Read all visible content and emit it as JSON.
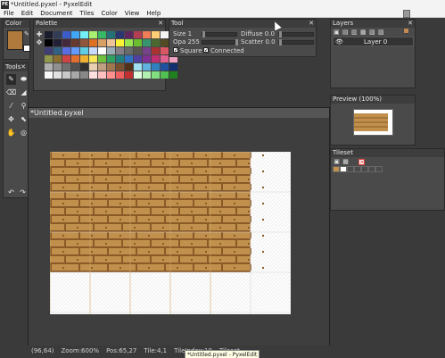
{
  "window": {
    "title": "*Untitled.pyxel - PyxelEdit",
    "icon_label": "PE"
  },
  "menu": [
    "File",
    "Edit",
    "Document",
    "Tiles",
    "Color",
    "View",
    "Help"
  ],
  "panels": {
    "color": {
      "title": "Color",
      "primary": "#b07a3c",
      "secondary": "#ffffff"
    },
    "palette": {
      "title": "Palette",
      "colors": [
        "#1a1c2c",
        "#333c57",
        "#3b5dc9",
        "#41a6f6",
        "#73eff7",
        "#a7f070",
        "#38b764",
        "#257179",
        "#29366f",
        "#5d275d",
        "#b13e53",
        "#ef7d57",
        "#ffcd75",
        "#f4f4f4",
        "#94b0c2",
        "#000000",
        "#222034",
        "#45283c",
        "#663931",
        "#8f563b",
        "#df7126",
        "#d9a066",
        "#eec39a",
        "#fbf236",
        "#99e550",
        "#6abe30",
        "#37946e",
        "#4b692f",
        "#524b24",
        "#323c39",
        "#3f3f74",
        "#306082",
        "#5b6ee1",
        "#639bff",
        "#5fcde4",
        "#cbdbfc",
        "#ffffff",
        "#9badb7",
        "#847e87",
        "#696a6a",
        "#595652",
        "#76428a",
        "#ac3232",
        "#d95763",
        "#d77bba",
        "#8f974a",
        "#8a6f30",
        "#cc4444",
        "#e07030",
        "#f0b030",
        "#f8e858",
        "#70c040",
        "#30a060",
        "#208080",
        "#3070c0",
        "#5040a0",
        "#803090",
        "#c03070",
        "#e06090",
        "#f0a0c0",
        "#b0b0b0",
        "#909090",
        "#707070",
        "#505050",
        "#303030",
        "#e8d0b0",
        "#c0a080",
        "#a07850",
        "#785030",
        "#503018",
        "#a0e0f0",
        "#60b0e0",
        "#3080c0",
        "#2050a0",
        "#103070",
        "#f8f8f8",
        "#e0e0e0",
        "#c8c8c8",
        "#a8a8a8",
        "#888888",
        "#ffe0e0",
        "#ffc0c0",
        "#ff9090",
        "#f06060",
        "#c03030",
        "#e0ffe0",
        "#b0f0b0",
        "#80e080",
        "#50c050",
        "#208020"
      ]
    },
    "tools": {
      "title": "Tools",
      "items": [
        "✎",
        "⬬",
        "⌫",
        "◢",
        "⁄",
        "⚲",
        "✥",
        "⬉",
        "✋",
        "◎",
        "↶",
        "↷"
      ]
    },
    "tool_options": {
      "title": "Tool",
      "size_label": "Size 1",
      "opacity_label": "Opa 255",
      "diffuse_label": "Diffuse 0.0",
      "scatter_label": "Scatter 0.0",
      "square_label": "Square",
      "connected_label": "Connected",
      "square_checked": true,
      "connected_checked": true
    },
    "layers": {
      "title": "Layers",
      "layer_name": "Layer 0"
    },
    "preview": {
      "title": "Preview (100%)"
    },
    "tileset": {
      "title": "Tileset"
    }
  },
  "document": {
    "tab_title": "*Untitled.pyxel",
    "colors": {
      "wood_light": "#c0904c",
      "wood_dark": "#8a5a28",
      "grid_line": "#e0e0e0"
    }
  },
  "status": {
    "coords": "(96,64)",
    "zoom": "Zoom:600%",
    "pos": "Pos:65,27",
    "tile": "Tile:4,1",
    "tile_index": "TileIndex:10",
    "tileset_partial": "Tileset",
    "tooltip": "*Untitled.pyxel - PyxelEdit"
  }
}
